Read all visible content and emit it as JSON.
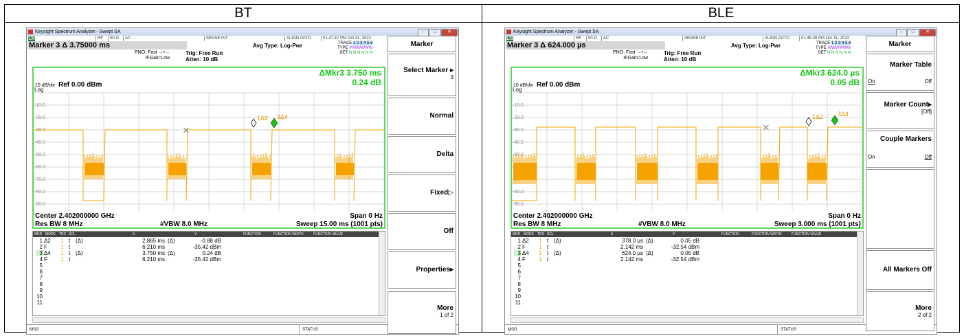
{
  "headers": [
    "BT",
    "BLE"
  ],
  "screens": [
    {
      "title": "Keysight Spectrum Analyzer - Swept SA",
      "lxi": "LXI",
      "rf": "RF",
      "impedance": "50 Ω",
      "coupling": "AC",
      "sense": "SENSE:INT",
      "align": "ALIGN AUTO",
      "datetime": "01:47:47 PM Oct 31, 2022",
      "marker_title": "Marker 3 Δ 3.75000 ms",
      "pno": "PNO: Fast",
      "ifgain": "IFGain:Low",
      "trig": "Trig: Free Run",
      "atten": "Atten: 10 dB",
      "avg": "Avg Type: Log-Pwr",
      "trace_label": "TRACE",
      "trace_nums": "1 2 3 4 5 6",
      "type_label": "TYPE",
      "type_val": "WWWWWW",
      "det_label": "DET",
      "det_val": "N N N N N N",
      "delta_mkr": "ΔMkr3 3.750 ms",
      "delta_val": "0.24 dB",
      "scale": "10 dB/div",
      "log": "Log",
      "ref": "Ref 0.00 dBm",
      "y_ticks": [
        "-10.0",
        "-20.0",
        "-30.0",
        "-40.0",
        "-50.0",
        "-60.0",
        "-70.0",
        "-80.0",
        "-90.0"
      ],
      "center": "Center 2.402000000 GHz",
      "span": "Span 0 Hz",
      "rbw": "Res BW 8 MHz",
      "vbw": "#VBW 8.0 MHz",
      "sweep": "Sweep  15.00 ms (1001 pts)",
      "marker_labels": [
        "1Δ2",
        "3Δ4"
      ],
      "table_headers": [
        "MKR",
        "MODE",
        "TRC",
        "SCL",
        "X",
        "Y",
        "FUNCTION",
        "FUNCTION WIDTH",
        "FUNCTION VALUE"
      ],
      "table_rows": [
        {
          "n": "1",
          "mode": "Δ2",
          "trc": "1",
          "scl": "t",
          "fn": "(Δ)",
          "x": "2.865 ms",
          "xu": "(Δ)",
          "y": "-0.88 dB"
        },
        {
          "n": "2",
          "mode": "F",
          "trc": "1",
          "scl": "t",
          "fn": "",
          "x": "6.210 ms",
          "xu": "",
          "y": "-35.42 dBm"
        },
        {
          "n": "3",
          "mode": "Δ4",
          "trc": "1",
          "scl": "t",
          "fn": "(Δ)",
          "x": "3.750 ms",
          "xu": "(Δ)",
          "y": "0.24 dB"
        },
        {
          "n": "4",
          "mode": "F",
          "trc": "1",
          "scl": "t",
          "fn": "",
          "x": "6.210 ms",
          "xu": "",
          "y": "-35.42 dBm"
        },
        {
          "n": "5"
        },
        {
          "n": "6"
        },
        {
          "n": "7"
        },
        {
          "n": "8"
        },
        {
          "n": "9"
        },
        {
          "n": "10"
        },
        {
          "n": "11"
        }
      ],
      "msg": "MSG",
      "status": "STATUS",
      "softkeys": {
        "header": "Marker",
        "k1": "Select Marker",
        "k1_sub": "3",
        "k2": "Normal",
        "k3": "Delta",
        "k4": "Fixed",
        "k5": "Off",
        "k6": "Properties",
        "k7": "More",
        "k7_sub": "1 of 2"
      }
    },
    {
      "title": "Keysight Spectrum Analyzer - Swept SA",
      "lxi": "LXI",
      "rf": "RF",
      "impedance": "50 Ω",
      "coupling": "AC",
      "sense": "SENSE:INT",
      "align": "ALIGN AUTO",
      "datetime": "01:45:38 PM Oct 31, 2022",
      "marker_title": "Marker 3 Δ 624.000 µs",
      "pno": "PNO: Fast",
      "ifgain": "IFGain:Low",
      "trig": "Trig: Free Run",
      "atten": "Atten: 10 dB",
      "avg": "Avg Type: Log-Pwr",
      "trace_label": "TRACE",
      "trace_nums": "1 2 3 4 5 6",
      "type_label": "TYPE",
      "type_val": "WWWWWW",
      "det_label": "DET",
      "det_val": "N N N N N N",
      "delta_mkr": "ΔMkr3 624.0 µs",
      "delta_val": "0.05 dB",
      "scale": "10 dB/div",
      "log": "Log",
      "ref": "Ref 0.00 dBm",
      "y_ticks": [
        "-10.0",
        "-20.0",
        "-30.0",
        "-40.0",
        "-50.0",
        "-60.0",
        "-70.0",
        "-80.0",
        "-90.0"
      ],
      "center": "Center 2.402000000 GHz",
      "span": "Span 0 Hz",
      "rbw": "Res BW 8 MHz",
      "vbw": "#VBW 8.0 MHz",
      "sweep": "Sweep  3.000 ms (1001 pts)",
      "marker_labels": [
        "1Δ2",
        "3Δ4"
      ],
      "table_headers": [
        "MKR",
        "MODE",
        "TRC",
        "SCL",
        "X",
        "Y",
        "FUNCTION",
        "FUNCTION WIDTH",
        "FUNCTION VALUE"
      ],
      "table_rows": [
        {
          "n": "1",
          "mode": "Δ2",
          "trc": "1",
          "scl": "t",
          "fn": "(Δ)",
          "x": "378.0 µs",
          "xu": "(Δ)",
          "y": "0.05 dB"
        },
        {
          "n": "2",
          "mode": "F",
          "trc": "1",
          "scl": "t",
          "fn": "",
          "x": "2.142 ms",
          "xu": "",
          "y": "-32.54 dBm"
        },
        {
          "n": "3",
          "mode": "Δ4",
          "trc": "1",
          "scl": "t",
          "fn": "(Δ)",
          "x": "624.0 µs",
          "xu": "(Δ)",
          "y": "0.05 dB"
        },
        {
          "n": "4",
          "mode": "F",
          "trc": "1",
          "scl": "t",
          "fn": "",
          "x": "2.142 ms",
          "xu": "",
          "y": "-32.54 dBm"
        },
        {
          "n": "5"
        },
        {
          "n": "6"
        },
        {
          "n": "7"
        },
        {
          "n": "8"
        },
        {
          "n": "9"
        },
        {
          "n": "10"
        },
        {
          "n": "11"
        }
      ],
      "msg": "MSG",
      "status": "STATUS",
      "softkeys": {
        "header": "Marker",
        "k1": "Marker Table",
        "k1_on": "On",
        "k1_off": "Off",
        "k2": "Marker Count",
        "k2_sub": "[Off]",
        "k3": "Couple Markers",
        "k3_on": "On",
        "k3_off": "Off",
        "k4": "All Markers Off",
        "k5": "More",
        "k5_sub": "2 of 2"
      }
    }
  ],
  "colors": {
    "trace": "#f5a300",
    "frame": "#5cd65c",
    "marker_green": "#16c516"
  }
}
